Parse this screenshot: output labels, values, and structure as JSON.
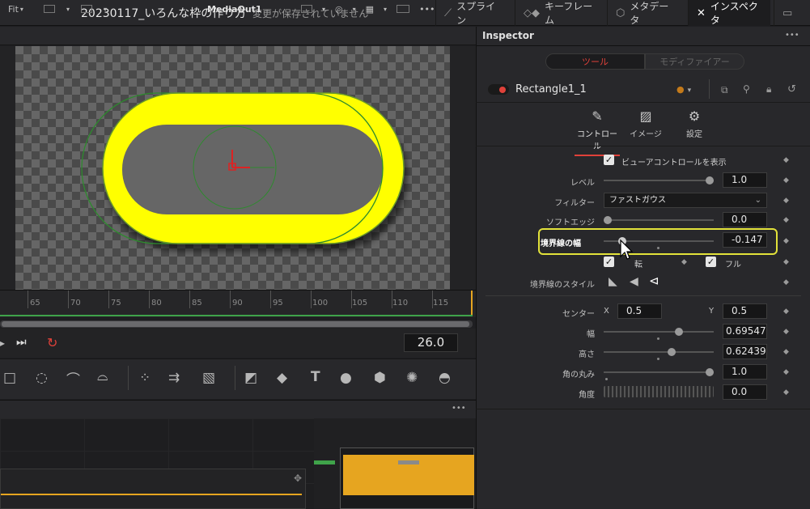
{
  "topbar": {
    "title": "20230117_いろんな枠の作り方",
    "unsaved": "変更が保存されていません",
    "buttons": [
      {
        "label": "スプライン",
        "icon": "spline-icon"
      },
      {
        "label": "キーフレーム",
        "icon": "keyframe-icon"
      },
      {
        "label": "メタデータ",
        "icon": "metadata-icon"
      },
      {
        "label": "インスペクタ",
        "icon": "inspector-icon"
      }
    ]
  },
  "viewer": {
    "fit": "Fit",
    "name": "MediaOut1"
  },
  "timeline": {
    "ticks": [
      "65",
      "70",
      "75",
      "80",
      "85",
      "90",
      "95",
      "100",
      "105",
      "110",
      "115"
    ],
    "current_frame": "26.0"
  },
  "inspector": {
    "title": "Inspector",
    "tabs": [
      "ツール",
      "モディファイアー"
    ],
    "node_name": "Rectangle1_1",
    "sub_tabs": [
      "コントロール",
      "イメージ",
      "設定"
    ],
    "show_view_controls": "ビューアコントロールを表示",
    "level": {
      "label": "レベル",
      "value": "1.0",
      "slider": 1.0
    },
    "filter": {
      "label": "フィルター",
      "value": "ファストガウス"
    },
    "soft_edge": {
      "label": "ソフトエッジ",
      "value": "0.0",
      "slider": 0.0
    },
    "border_width": {
      "label": "境界線の幅",
      "value": "-0.147",
      "slider": 0.15
    },
    "invert_label": "転",
    "solid_label": "フル",
    "border_style_label": "境界線のスタイル",
    "center": {
      "label": "センター",
      "x_label": "X",
      "x": "0.5",
      "y_label": "Y",
      "y": "0.5"
    },
    "width": {
      "label": "幅",
      "value": "0.695473",
      "slider": 0.69
    },
    "height": {
      "label": "高さ",
      "value": "0.624390",
      "slider": 0.62
    },
    "corner_radius": {
      "label": "角の丸み",
      "value": "1.0",
      "slider": 1.0
    },
    "angle": {
      "label": "角度",
      "value": "0.0"
    }
  },
  "colors": {
    "accent_red": "#e0413a",
    "highlight_yellow": "#e2e23a",
    "shape_yellow": "#ffff00",
    "clip_orange": "#e6a520"
  }
}
